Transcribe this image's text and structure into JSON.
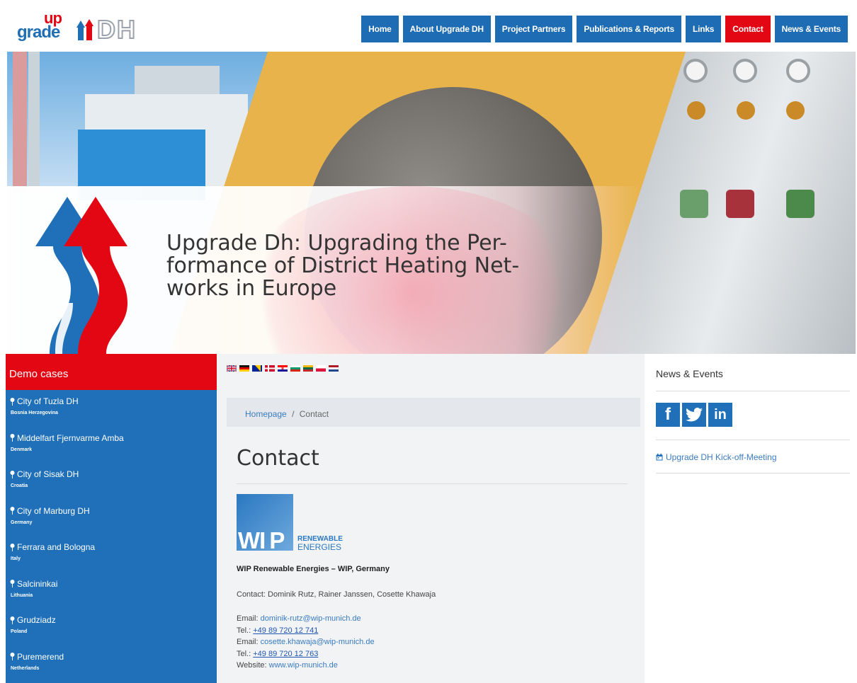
{
  "header": {
    "logo_up": "up",
    "logo_grade": "grade",
    "logo_dh": "DH",
    "nav": [
      {
        "label": "Home"
      },
      {
        "label": "About Upgrade DH"
      },
      {
        "label": "Project Partners"
      },
      {
        "label": "Publications & Reports"
      },
      {
        "label": "Links"
      },
      {
        "label": "Contact",
        "active": true
      },
      {
        "label": "News & Events"
      }
    ]
  },
  "hero": {
    "title": "Upgrade Dh: Upgrading the Per-formance of District Heating Net-works in Europe",
    "title_lines": [
      "Upgrade Dh: Upgrading the Per-",
      "formance of District Heating Net-",
      "works in Europe"
    ]
  },
  "sidebar": {
    "heading": "Demo cases",
    "items": [
      {
        "name": "City of Tuzla DH",
        "country": "Bosnia Herzegovina"
      },
      {
        "name": "Middelfart Fjernvarme Amba",
        "country": "Denmark"
      },
      {
        "name": "City of Sisak DH",
        "country": "Croatia"
      },
      {
        "name": "City of Marburg DH",
        "country": "Germany"
      },
      {
        "name": "Ferrara and Bologna",
        "country": "Italy"
      },
      {
        "name": "Salcininkai",
        "country": "Lithuania"
      },
      {
        "name": "Grudziadz",
        "country": "Poland"
      },
      {
        "name": "Puremerend",
        "country": "Netherlands"
      }
    ]
  },
  "languages": [
    "uk-flag-icon",
    "germany-flag-icon",
    "bosnia-flag-icon",
    "denmark-flag-icon",
    "croatia-flag-icon",
    "bulgaria-flag-icon",
    "lithuania-flag-icon",
    "poland-flag-icon",
    "netherlands-flag-icon"
  ],
  "breadcrumb": {
    "home": "Homepage",
    "separator": "/",
    "current": "Contact"
  },
  "content": {
    "title": "Contact",
    "wip_logo": {
      "letters_a": "WI",
      "letters_b": "P",
      "line1": "RENEWABLE",
      "line2": "ENERGIES"
    },
    "org_name": "WIP  Renewable Energies – WIP, Germany",
    "contact_line": "Contact: Dominik Rutz, Rainer Janssen, Cosette Khawaja",
    "email1_label": "Email:",
    "email1": "dominik-rutz@wip-munich.de",
    "tel1_label": "Tel.:",
    "tel1": "+49 89 720 12 741",
    "email2_label": "Email:",
    "email2": "cosette.khawaja@wip-munich.de",
    "tel2_label": "Tel.:",
    "tel2": "+49 89 720 12 763",
    "website_label": "Website:",
    "website": "www.wip-munich.de"
  },
  "right": {
    "heading": "News & Events",
    "social": [
      {
        "icon": "facebook-icon",
        "glyph": "f"
      },
      {
        "icon": "twitter-icon",
        "glyph": "t"
      },
      {
        "icon": "linkedin-icon",
        "glyph": "in"
      }
    ],
    "news": [
      {
        "label": "Upgrade DH Kick-off-Meeting"
      }
    ]
  },
  "colors": {
    "brand_blue": "#1e6cb3",
    "brand_red": "#e30613",
    "link": "#3a7bbf"
  }
}
